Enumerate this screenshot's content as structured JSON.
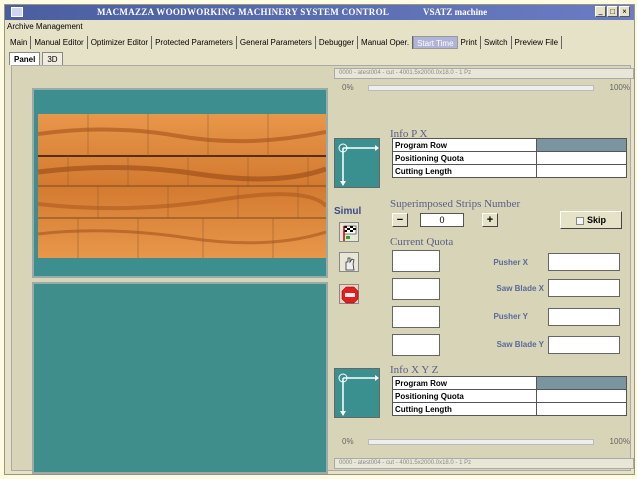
{
  "window": {
    "title": "MACMAZZA WOODWORKING MACHINERY SYSTEM CONTROL",
    "machine": "VSATZ machine",
    "controls": [
      "_",
      "□",
      "×"
    ]
  },
  "menu": {
    "label": "Archive Management"
  },
  "tabs": [
    "Main",
    "Manual Editor",
    "Optimizer Editor",
    "Protected Parameters",
    "General Parameters",
    "Debugger",
    "Manual Oper.",
    "Start Time",
    "Print",
    "Switch",
    "Preview File"
  ],
  "active_tab": "Start Time",
  "subtabs": [
    "Panel",
    "3D"
  ],
  "status_top": "0000 - atest004 - cut - 4001.5x2000.0x18.0 - 1 Pz",
  "status_bottom": "0000 - atest004 - cut - 4001.5x2000.0x18.0 - 1 Pz",
  "progress_top": {
    "left": "0%",
    "right": "100%",
    "value": 0
  },
  "progress_bottom": {
    "left": "0%",
    "right": "100%",
    "value": 0
  },
  "info_px": {
    "title": "Info P X",
    "rows": [
      "Program Row",
      "Positioning Quota",
      "Cutting Length"
    ]
  },
  "info_xyz": {
    "title": "Info X Y Z",
    "rows": [
      "Program Row",
      "Positioning Quota",
      "Cutting Length"
    ]
  },
  "simul": {
    "label": "Simul"
  },
  "strips": {
    "title": "Superimposed Strips Number",
    "minus": "−",
    "value": "0",
    "plus": "+",
    "skip": "Skip"
  },
  "quota": {
    "title": "Current Quota",
    "labels": [
      "Pusher X",
      "Saw Blade X",
      "Pusher Y",
      "Saw Blade Y"
    ]
  },
  "colors": {
    "panel": "#3d8f8f",
    "titlebar": "#4b5ea0",
    "wood": "#d9843a"
  }
}
